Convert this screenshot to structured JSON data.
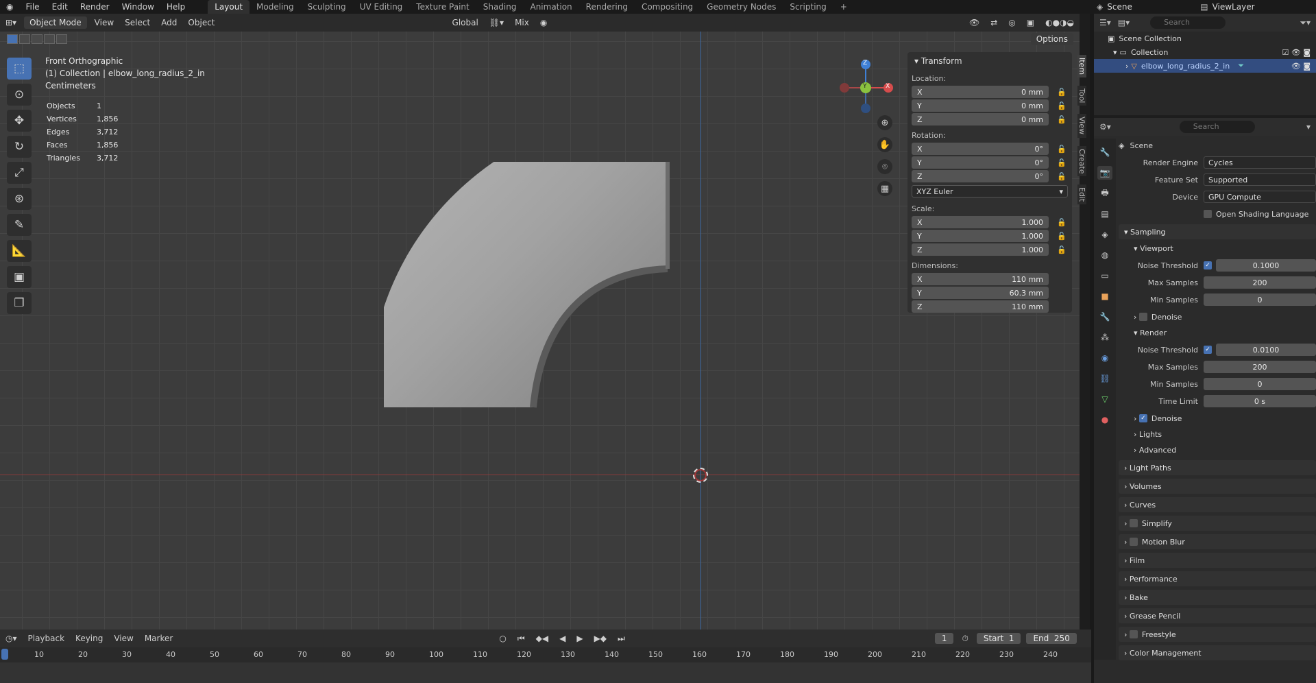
{
  "topbar": {
    "menus": [
      "File",
      "Edit",
      "Render",
      "Window",
      "Help"
    ],
    "workspaces": [
      "Layout",
      "Modeling",
      "Sculpting",
      "UV Editing",
      "Texture Paint",
      "Shading",
      "Animation",
      "Rendering",
      "Compositing",
      "Geometry Nodes",
      "Scripting"
    ],
    "add": "+",
    "scene": "Scene",
    "viewlayer": "ViewLayer"
  },
  "viewport": {
    "mode": "Object Mode",
    "menus": [
      "View",
      "Select",
      "Add",
      "Object"
    ],
    "transform_orientation": "Global",
    "snap_mix": "Mix",
    "options": "Options",
    "view_name": "Front Orthographic",
    "collection_line": "(1) Collection | elbow_long_radius_2_in",
    "units": "Centimeters",
    "stats": [
      {
        "k": "Objects",
        "v": "1"
      },
      {
        "k": "Vertices",
        "v": "1,856"
      },
      {
        "k": "Edges",
        "v": "3,712"
      },
      {
        "k": "Faces",
        "v": "1,856"
      },
      {
        "k": "Triangles",
        "v": "3,712"
      }
    ],
    "gizmo": {
      "z": "Z",
      "y": "Y",
      "x": "X"
    }
  },
  "npanel": {
    "title": "Transform",
    "location_label": "Location:",
    "rotation_label": "Rotation:",
    "scale_label": "Scale:",
    "dimensions_label": "Dimensions:",
    "location": [
      {
        "a": "X",
        "v": "0 mm"
      },
      {
        "a": "Y",
        "v": "0 mm"
      },
      {
        "a": "Z",
        "v": "0 mm"
      }
    ],
    "rotation": [
      {
        "a": "X",
        "v": "0°"
      },
      {
        "a": "Y",
        "v": "0°"
      },
      {
        "a": "Z",
        "v": "0°"
      }
    ],
    "rotation_mode": "XYZ Euler",
    "scale": [
      {
        "a": "X",
        "v": "1.000"
      },
      {
        "a": "Y",
        "v": "1.000"
      },
      {
        "a": "Z",
        "v": "1.000"
      }
    ],
    "dimensions": [
      {
        "a": "X",
        "v": "110 mm"
      },
      {
        "a": "Y",
        "v": "60.3 mm"
      },
      {
        "a": "Z",
        "v": "110 mm"
      }
    ],
    "tabs": [
      "Item",
      "Tool",
      "View",
      "Create",
      "Edit"
    ]
  },
  "outliner": {
    "search": "Search",
    "scene_collection": "Scene Collection",
    "collection": "Collection",
    "object": "elbow_long_radius_2_in"
  },
  "props": {
    "search": "Search",
    "context": "Scene",
    "render_engine_label": "Render Engine",
    "render_engine": "Cycles",
    "feature_set_label": "Feature Set",
    "feature_set": "Supported",
    "device_label": "Device",
    "device": "GPU Compute",
    "osl": "Open Shading Language",
    "sampling": "Sampling",
    "viewport": "Viewport",
    "render": "Render",
    "noise_threshold": "Noise Threshold",
    "vp_noise": "0.1000",
    "max_samples": "Max Samples",
    "vp_max": "200",
    "min_samples": "Min Samples",
    "vp_min": "0",
    "denoise": "Denoise",
    "r_noise": "0.0100",
    "r_max": "200",
    "r_min": "0",
    "time_limit": "Time Limit",
    "r_time": "0 s",
    "lights": "Lights",
    "advanced": "Advanced",
    "sections": [
      "Light Paths",
      "Volumes",
      "Curves",
      "Simplify",
      "Motion Blur",
      "Film",
      "Performance",
      "Bake",
      "Grease Pencil",
      "Freestyle",
      "Color Management"
    ]
  },
  "timeline": {
    "menus": [
      "Playback",
      "Keying",
      "View",
      "Marker"
    ],
    "current": "1",
    "start_label": "Start",
    "start": "1",
    "end_label": "End",
    "end": "250",
    "ticks": [
      "10",
      "20",
      "30",
      "40",
      "50",
      "60",
      "70",
      "80",
      "90",
      "100",
      "110",
      "120",
      "130",
      "140",
      "150",
      "160",
      "170",
      "180",
      "190",
      "200",
      "210",
      "220",
      "230",
      "240"
    ]
  }
}
